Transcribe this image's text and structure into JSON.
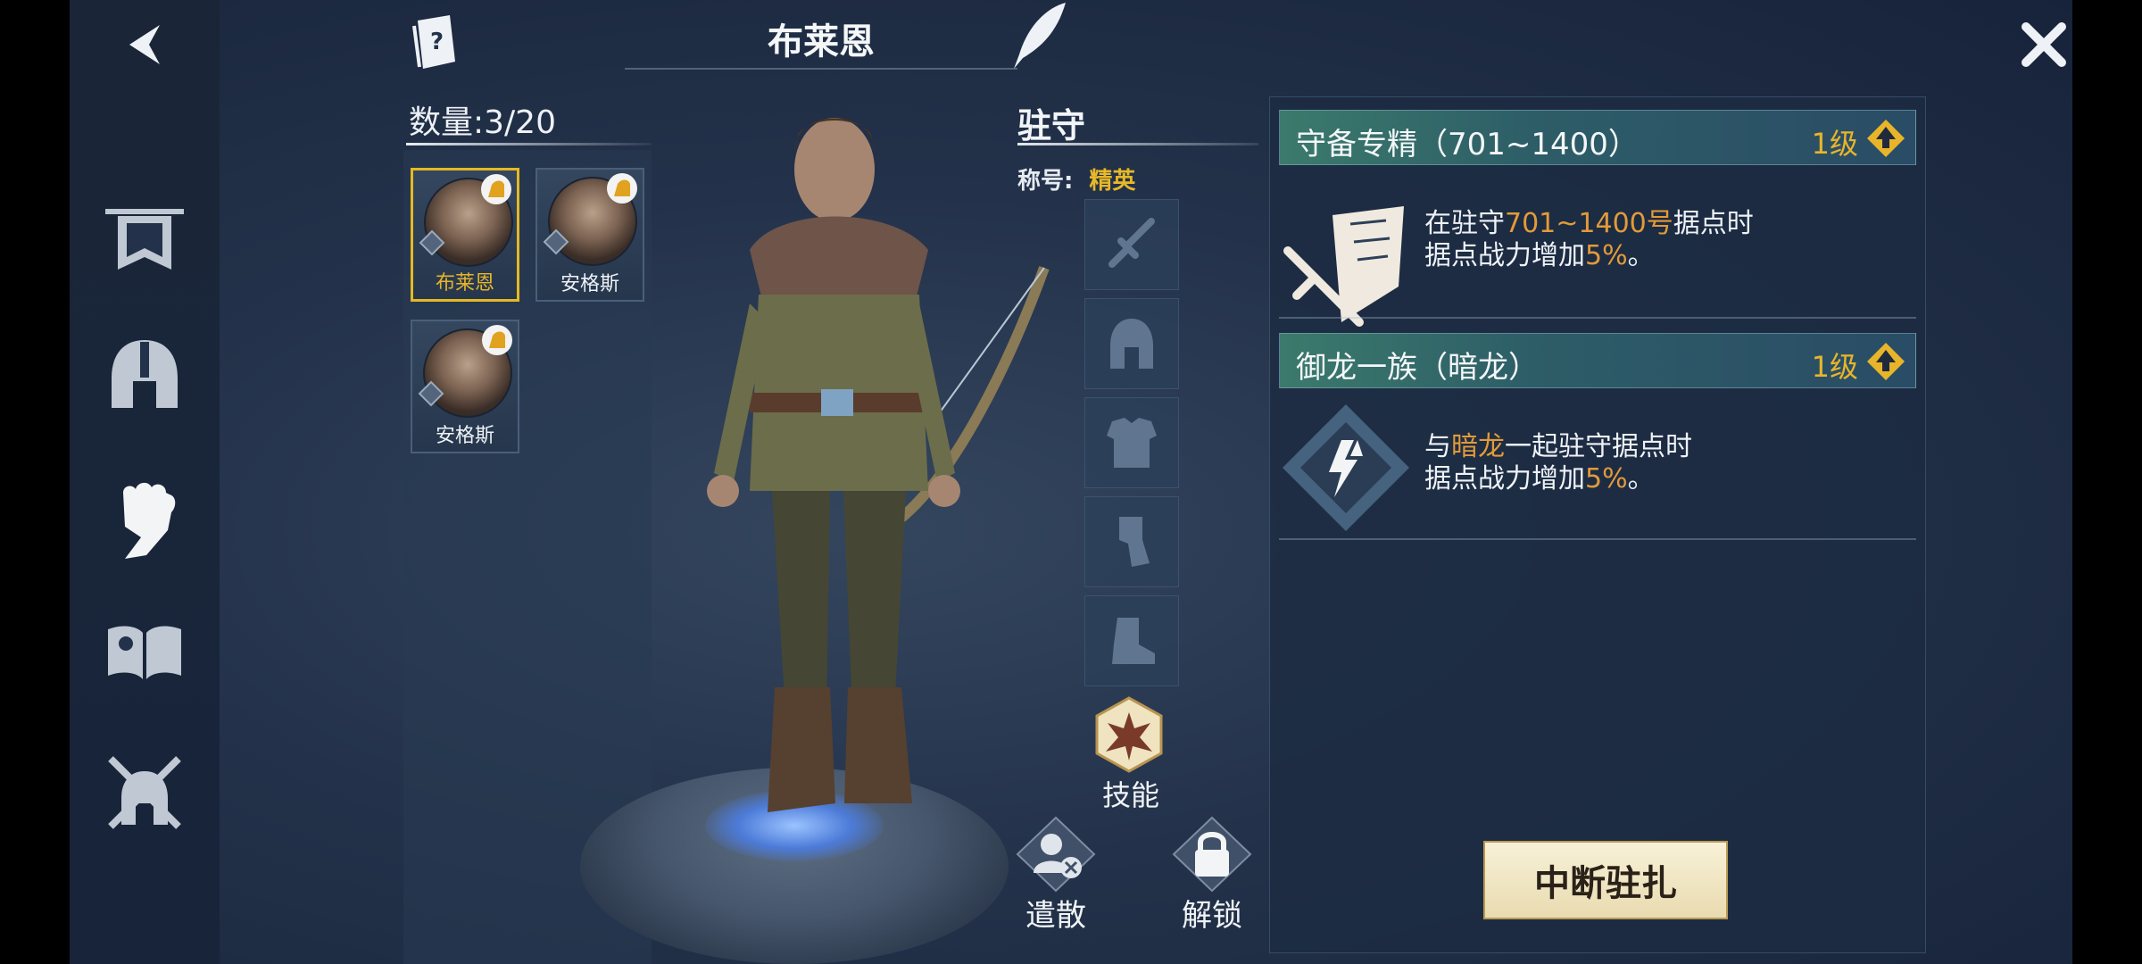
{
  "header": {
    "title": "布莱恩"
  },
  "roster": {
    "count_label": "数量:3/20",
    "heroes": [
      {
        "name": "布莱恩",
        "selected": true
      },
      {
        "name": "安格斯",
        "selected": false
      },
      {
        "name": "安格斯",
        "selected": false
      }
    ]
  },
  "garrison": {
    "title": "驻守",
    "title_key": "称号:",
    "title_value": "精英",
    "equipment_icons": [
      "sword-icon",
      "helmet-icon",
      "armor-icon",
      "leg-armor-icon",
      "boots-icon"
    ],
    "skill_label": "技能",
    "dismiss_label": "遣散",
    "unlock_label": "解锁"
  },
  "skills": [
    {
      "name": "守备专精（701~1400）",
      "level": "1级",
      "desc_line1_pre": "在驻守",
      "desc_line1_hl": "701~1400号",
      "desc_line1_post": "据点时",
      "desc_line2_pre": "据点战力增加",
      "desc_line2_hl": "5%",
      "desc_line2_post": "。"
    },
    {
      "name": "御龙一族（暗龙）",
      "level": "1级",
      "desc_line1_pre": "与",
      "desc_line1_hl": "暗龙",
      "desc_line1_post": "一起驻守据点时",
      "desc_line2_pre": "据点战力增加",
      "desc_line2_hl": "5%",
      "desc_line2_post": "。"
    }
  ],
  "actions": {
    "stop_garrison": "中断驻扎"
  },
  "colors": {
    "accent_gold": "#e8b52a",
    "highlight_orange": "#e39a3a",
    "panel_teal": "#3b7a6c"
  }
}
